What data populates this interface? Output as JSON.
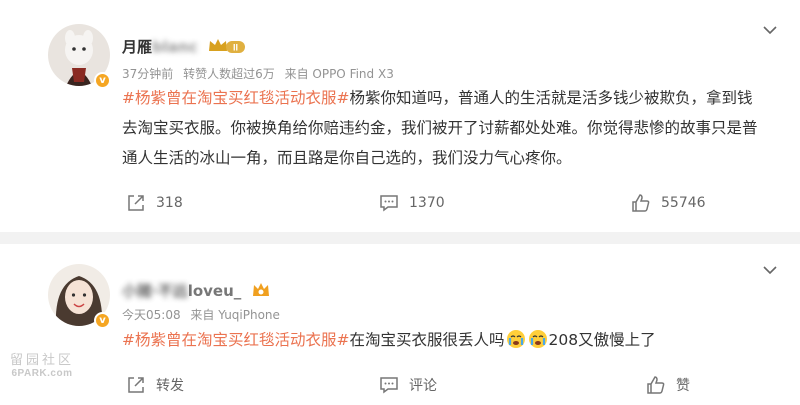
{
  "colors": {
    "accent": "#eb7350",
    "meta_gray": "#939393",
    "badge_orange": "#f5a623"
  },
  "post": {
    "author_visible": "月雁",
    "author_blurred": "blanc",
    "rank_badge": "II",
    "meta": {
      "time": "37分钟前",
      "repost_info": "转赞人数超过6万",
      "source": "来自 OPPO Find X3"
    },
    "hashtag": "#杨紫曾在淘宝买红毯活动衣服#",
    "text": "杨紫你知道吗，普通人的生活就是活多钱少被欺负，拿到钱去淘宝买衣服。你被换角给你赔违约金，我们被开了讨薪都处处难。你觉得悲惨的故事只是普通人生活的冰山一角，而且路是你自己选的，我们没力气心疼你。",
    "counts": {
      "repost": "318",
      "comment": "1370",
      "like": "55746"
    }
  },
  "reply": {
    "author_blurred": "小猪·不远",
    "author_visible": "loveu_",
    "meta": {
      "time": "今天05:08",
      "source": "来自 YuqiPhone"
    },
    "hashtag": "#杨紫曾在淘宝买红毯活动衣服#",
    "text_before_emoji": "在淘宝买衣服很丢人吗",
    "text_after_emoji": "208又傲慢上了",
    "actions": {
      "repost": "转发",
      "comment": "评论",
      "like": "赞"
    }
  },
  "watermark": {
    "top": "留园社区",
    "bottom": "6PARK.com"
  },
  "icons": [
    "chevron-down-icon",
    "repost-icon",
    "comment-icon",
    "like-icon",
    "verified-badge-icon",
    "crying-emoji-icon",
    "crown-badge-icon"
  ]
}
